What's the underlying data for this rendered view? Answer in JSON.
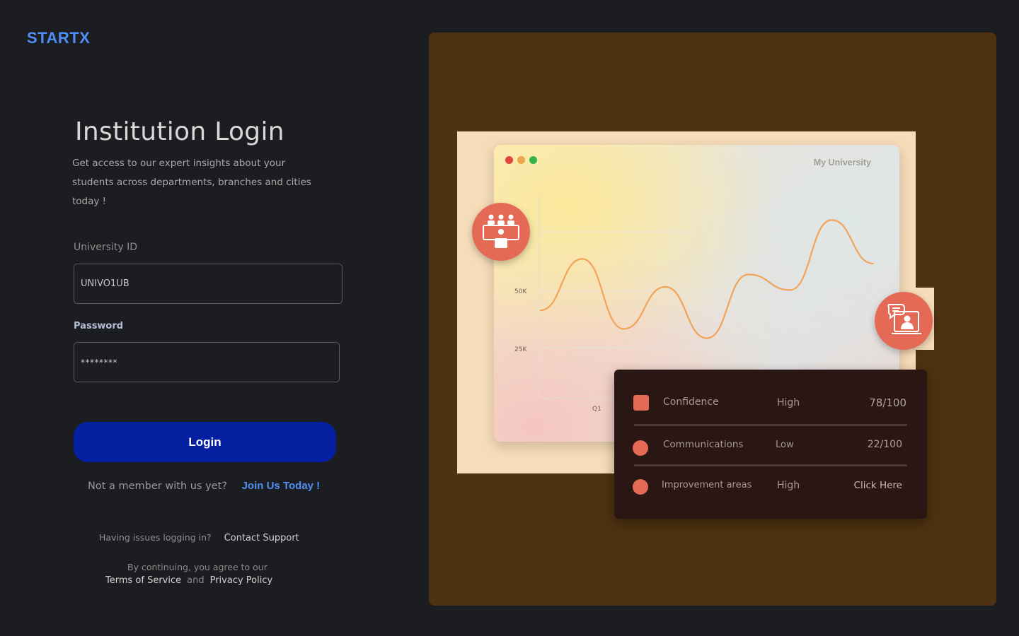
{
  "brand": {
    "logo": "STARTX",
    "accent": "#4f8ff5"
  },
  "login": {
    "title": "Institution Login",
    "subtitle": "Get access to our expert insights about your students across departments, branches and cities today !",
    "id_label": "University ID",
    "id_value": "UNIVO1UB",
    "password_label": "Password",
    "password_value": "********",
    "submit_label": "Login",
    "submit_color": "#0420a0"
  },
  "signup": {
    "prompt": "Not a member with us yet?",
    "link": "Join Us Today !"
  },
  "support": {
    "prompt": "Having issues logging in?",
    "link": "Contact Support"
  },
  "legal": {
    "line1": "By continuing, you agree to our",
    "terms": "Terms of Service",
    "and": "and",
    "privacy": "Privacy Policy"
  },
  "illustration": {
    "window_title": "My University",
    "badge_icons": [
      "classroom-icon",
      "online-tutor-icon"
    ],
    "chart_data": {
      "type": "line",
      "y_ticks": [
        "50K",
        "25K"
      ],
      "x_ticks": [
        "Q1"
      ],
      "values": [
        30,
        63,
        18,
        45,
        12,
        53,
        43,
        88,
        60
      ],
      "line_color": "#f2a35a"
    },
    "stats": [
      {
        "name": "Confidence",
        "level": "High",
        "score": "78/100",
        "icon": "confidence-icon"
      },
      {
        "name": "Communications",
        "level": "Low",
        "score": "22/100",
        "icon": "communication-icon"
      },
      {
        "name": "Improvement areas",
        "level": "High",
        "score": "Click Here",
        "icon": "improvement-icon"
      }
    ]
  }
}
